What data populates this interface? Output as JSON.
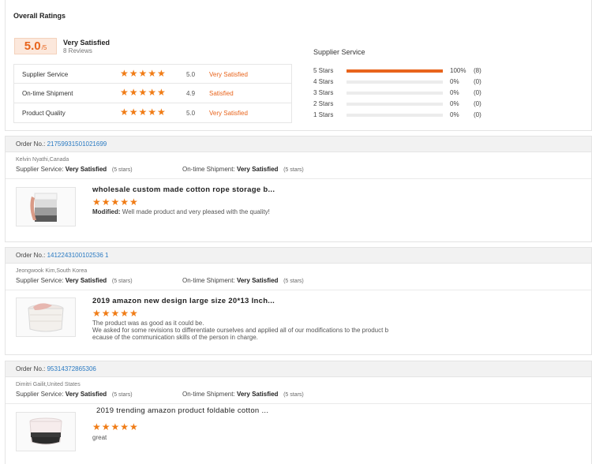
{
  "summary": {
    "title": "Overall Ratings",
    "score": "5.0",
    "score_suffix": "/5",
    "overall_label": "Very Satisfied",
    "review_count": "8 Reviews",
    "categories": [
      {
        "name": "Supplier Service",
        "score": "5.0",
        "label": "Very Satisfied",
        "stars": 5
      },
      {
        "name": "On-time Shipment",
        "score": "4.9",
        "label": "Satisfied",
        "stars": 5
      },
      {
        "name": "Product Quality",
        "score": "5.0",
        "label": "Very Satisfied",
        "stars": 5
      }
    ],
    "distribution_title": "Supplier Service",
    "distribution": [
      {
        "label": "5 Stars",
        "fraction": 1.0,
        "pct": "100%",
        "count": "(8)"
      },
      {
        "label": "4 Stars",
        "fraction": 0,
        "pct": "0%",
        "count": "(0)"
      },
      {
        "label": "3 Stars",
        "fraction": 0,
        "pct": "0%",
        "count": "(0)"
      },
      {
        "label": "2 Stars",
        "fraction": 0,
        "pct": "0%",
        "count": "(0)"
      },
      {
        "label": "1 Stars",
        "fraction": 0,
        "pct": "0%",
        "count": "(0)"
      }
    ],
    "accent_color": "#e8641c",
    "star_color": "#f07c16"
  },
  "labels": {
    "order_no": "Order No.:",
    "supplier_service": "Supplier Service:",
    "ontime_shipment": "On-time Shipment:",
    "modified": "Modified:"
  },
  "orders": [
    {
      "order_no": "21759931501021699",
      "reviewer": "Kelvin Nyathi,Canada",
      "supplier_rating": "Very Satisfied",
      "supplier_stars": "(5 stars)",
      "shipment_rating": "Very Satisfied",
      "shipment_stars": "(5 stars)",
      "product_title": "wholesale custom made cotton rope storage b...",
      "product_stars": 5,
      "comment_prefix": "Modified:",
      "comment": "Well made product and very pleased with the quality!",
      "thumb_icon": "rope-basket-image"
    },
    {
      "order_no": "1412243100102536 1",
      "reviewer": "Jeongwook Kim,South Korea",
      "supplier_rating": "Very Satisfied",
      "supplier_stars": "(5 stars)",
      "shipment_rating": "Very Satisfied",
      "shipment_stars": "(5 stars)",
      "product_title": "2019 amazon new design large size 20*13 Inch...",
      "product_stars": 5,
      "comment_lines": [
        "The product was as good as it could be.",
        "We asked for some revisions to differentiate ourselves and applied all of our modifications to the product b",
        "ecause of the communication skills of the person in charge."
      ],
      "thumb_icon": "rope-basket-image"
    },
    {
      "order_no": "95314372865306",
      "reviewer": "Dimitri Gailit,United States",
      "supplier_rating": "Very Satisfied",
      "supplier_stars": "(5 stars)",
      "shipment_rating": "Very Satisfied",
      "shipment_stars": "(5 stars)",
      "product_title": "2019 trending amazon product foldable cotton ...",
      "product_stars": 5,
      "comment": "great",
      "thumb_icon": "rope-basket-image"
    }
  ]
}
